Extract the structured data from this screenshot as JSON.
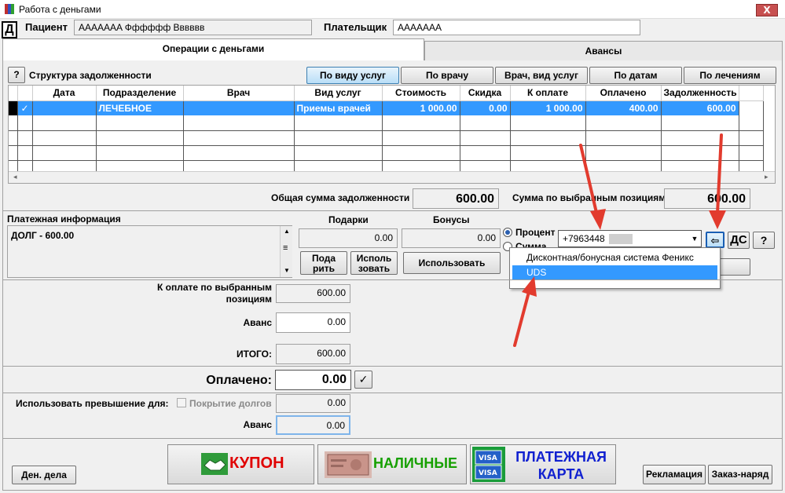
{
  "window": {
    "title": "Работа с деньгами",
    "close": "X"
  },
  "header": {
    "d_label": "Д",
    "patient_label": "Пациент",
    "patient_value": "АААААAA Фффффф Вввввв",
    "payer_label": "Плательщик",
    "payer_value": "АААААAA"
  },
  "tabs": [
    {
      "label": "Операции с деньгами"
    },
    {
      "label": "Авансы"
    }
  ],
  "debt": {
    "help": "?",
    "structure_label": "Структура задолженности",
    "filters": [
      {
        "label": "По виду услуг"
      },
      {
        "label": "По врачу"
      },
      {
        "label": "Врач, вид услуг"
      },
      {
        "label": "По датам"
      },
      {
        "label": "По лечениям"
      }
    ],
    "columns": [
      "Дата",
      "Подразделение",
      "Врач",
      "Вид услуг",
      "Стоимость",
      "Скидка",
      "К оплате",
      "Оплачено",
      "Задолженность"
    ],
    "rows": [
      {
        "check": "✓",
        "date": "",
        "dept": "ЛЕЧЕБНОЕ",
        "doctor": "",
        "service": "Приемы врачей",
        "cost": "1 000.00",
        "discount": "0.00",
        "to_pay": "1 000.00",
        "paid": "400.00",
        "debt": "600.00"
      }
    ],
    "total_label": "Общая сумма задолженности",
    "total_value": "600.00",
    "selected_label": "Сумма по выбранным позициям",
    "selected_value": "600.00"
  },
  "payment_info": {
    "label": "Платежная информация",
    "text": "ДОЛГ - 600.00",
    "gifts_label": "Подарки",
    "gifts_value": "0.00",
    "bonus_label": "Бонусы",
    "bonus_value": "0.00",
    "give_btn": [
      "Пода",
      "рить"
    ],
    "use_btn": [
      "Исполь",
      "зовать"
    ],
    "use_bonus_btn": "Использовать",
    "radio_percent": "Процент",
    "radio_sum": "Сумма",
    "phone_value": "+7963448",
    "ds_btn": "ДС",
    "help_btn": "?",
    "dropdown_options": [
      "Дисконтная/бонусная система Феникс",
      "UDS"
    ]
  },
  "payment": {
    "to_pay_label": "К оплате по выбранным позициям",
    "to_pay_value": "600.00",
    "advance_label": "Аванс",
    "advance_value": "0.00",
    "total_label": "ИТОГО:",
    "total_value": "600.00",
    "paid_label": "Оплачено:",
    "paid_value": "0.00",
    "overpay_label": "Использовать превышение для:",
    "cover_debt_label": "Покрытие долгов",
    "cover_debt_value": "0.00",
    "overpay_advance_label": "Аванс",
    "overpay_advance_value": "0.00"
  },
  "footer": {
    "money_btn": "Ден. дела",
    "coupon_btn": "КУПОН",
    "cash_btn": "НАЛИЧНЫЕ",
    "card_btn": [
      "ПЛАТЕЖНАЯ",
      "КАРТА"
    ],
    "ads_btn": "Рекламация",
    "order_btn": "Заказ-наряд",
    "visa": "VISA"
  },
  "colors": {
    "selected_row": "#3399ff",
    "coupon_text": "#e00000",
    "cash_text": "#16a000",
    "card_text": "#1020d0",
    "arrow": "#e23b2e"
  }
}
